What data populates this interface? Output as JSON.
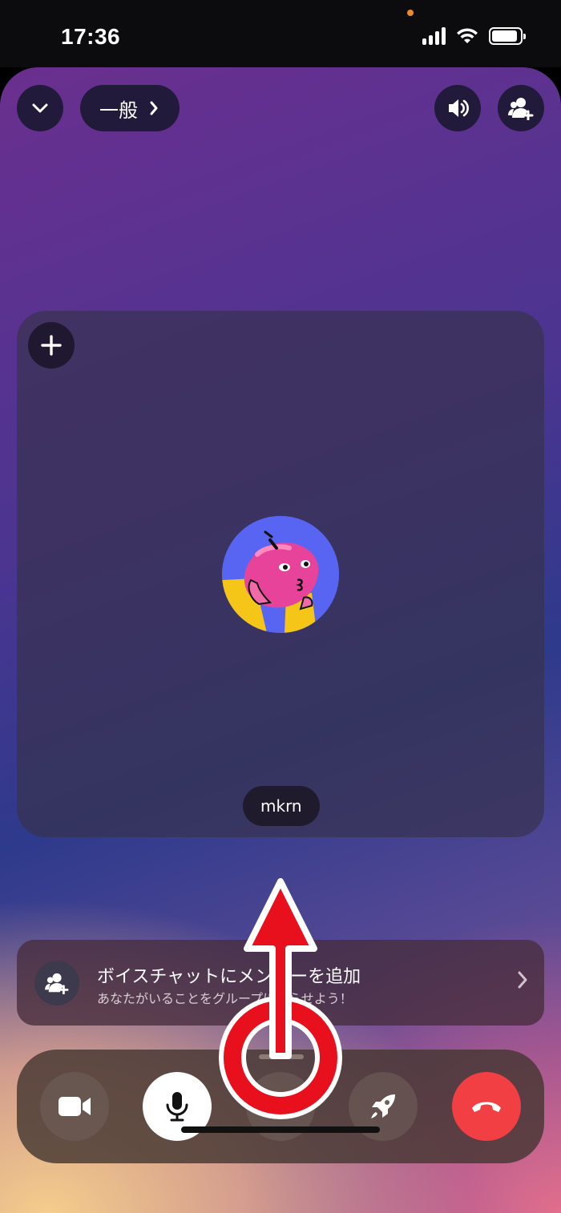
{
  "status_bar": {
    "time": "17:36",
    "privacy_dot_color": "#f08a24",
    "battery_level": 0.9
  },
  "header": {
    "channel_name": "一般",
    "collapse_icon": "chevron-down-icon",
    "speaker_icon": "speaker-icon",
    "add_member_icon": "add-person-icon"
  },
  "tile": {
    "username": "mkrn",
    "add_icon": "plus-icon"
  },
  "invite": {
    "title": "ボイスチャットにメンバーを追加",
    "subtitle": "あなたがいることをグループに知らせよう！"
  },
  "controls": {
    "camera_icon": "camera-icon",
    "mic_icon": "microphone-icon",
    "chat_icon": "chat-bubble-icon",
    "activity_icon": "rocket-icon",
    "hangup_icon": "hang-up-icon",
    "hangup_color": "#f23f43",
    "mic_active_color": "#ffffff"
  },
  "annotation": {
    "color": "#e8101c",
    "kind": "swipe-up-gesture"
  }
}
